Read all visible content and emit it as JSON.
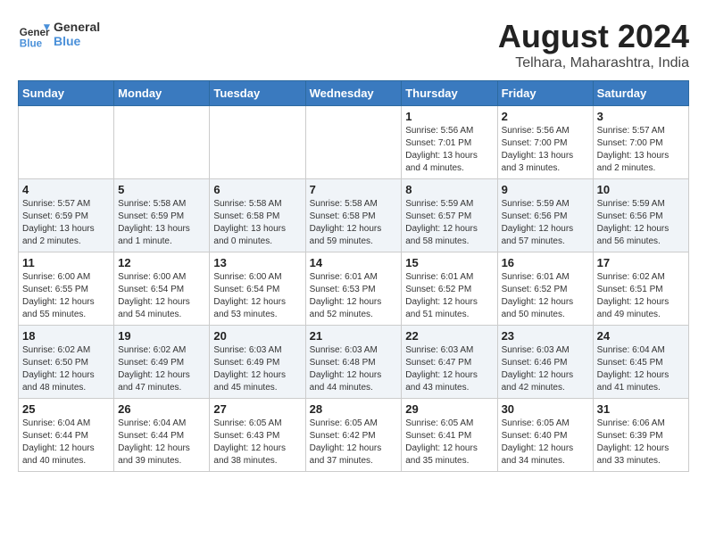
{
  "header": {
    "logo_line1": "General",
    "logo_line2": "Blue",
    "month_year": "August 2024",
    "location": "Telhara, Maharashtra, India"
  },
  "weekdays": [
    "Sunday",
    "Monday",
    "Tuesday",
    "Wednesday",
    "Thursday",
    "Friday",
    "Saturday"
  ],
  "weeks": [
    [
      {
        "day": "",
        "info": ""
      },
      {
        "day": "",
        "info": ""
      },
      {
        "day": "",
        "info": ""
      },
      {
        "day": "",
        "info": ""
      },
      {
        "day": "1",
        "info": "Sunrise: 5:56 AM\nSunset: 7:01 PM\nDaylight: 13 hours\nand 4 minutes."
      },
      {
        "day": "2",
        "info": "Sunrise: 5:56 AM\nSunset: 7:00 PM\nDaylight: 13 hours\nand 3 minutes."
      },
      {
        "day": "3",
        "info": "Sunrise: 5:57 AM\nSunset: 7:00 PM\nDaylight: 13 hours\nand 2 minutes."
      }
    ],
    [
      {
        "day": "4",
        "info": "Sunrise: 5:57 AM\nSunset: 6:59 PM\nDaylight: 13 hours\nand 2 minutes."
      },
      {
        "day": "5",
        "info": "Sunrise: 5:58 AM\nSunset: 6:59 PM\nDaylight: 13 hours\nand 1 minute."
      },
      {
        "day": "6",
        "info": "Sunrise: 5:58 AM\nSunset: 6:58 PM\nDaylight: 13 hours\nand 0 minutes."
      },
      {
        "day": "7",
        "info": "Sunrise: 5:58 AM\nSunset: 6:58 PM\nDaylight: 12 hours\nand 59 minutes."
      },
      {
        "day": "8",
        "info": "Sunrise: 5:59 AM\nSunset: 6:57 PM\nDaylight: 12 hours\nand 58 minutes."
      },
      {
        "day": "9",
        "info": "Sunrise: 5:59 AM\nSunset: 6:56 PM\nDaylight: 12 hours\nand 57 minutes."
      },
      {
        "day": "10",
        "info": "Sunrise: 5:59 AM\nSunset: 6:56 PM\nDaylight: 12 hours\nand 56 minutes."
      }
    ],
    [
      {
        "day": "11",
        "info": "Sunrise: 6:00 AM\nSunset: 6:55 PM\nDaylight: 12 hours\nand 55 minutes."
      },
      {
        "day": "12",
        "info": "Sunrise: 6:00 AM\nSunset: 6:54 PM\nDaylight: 12 hours\nand 54 minutes."
      },
      {
        "day": "13",
        "info": "Sunrise: 6:00 AM\nSunset: 6:54 PM\nDaylight: 12 hours\nand 53 minutes."
      },
      {
        "day": "14",
        "info": "Sunrise: 6:01 AM\nSunset: 6:53 PM\nDaylight: 12 hours\nand 52 minutes."
      },
      {
        "day": "15",
        "info": "Sunrise: 6:01 AM\nSunset: 6:52 PM\nDaylight: 12 hours\nand 51 minutes."
      },
      {
        "day": "16",
        "info": "Sunrise: 6:01 AM\nSunset: 6:52 PM\nDaylight: 12 hours\nand 50 minutes."
      },
      {
        "day": "17",
        "info": "Sunrise: 6:02 AM\nSunset: 6:51 PM\nDaylight: 12 hours\nand 49 minutes."
      }
    ],
    [
      {
        "day": "18",
        "info": "Sunrise: 6:02 AM\nSunset: 6:50 PM\nDaylight: 12 hours\nand 48 minutes."
      },
      {
        "day": "19",
        "info": "Sunrise: 6:02 AM\nSunset: 6:49 PM\nDaylight: 12 hours\nand 47 minutes."
      },
      {
        "day": "20",
        "info": "Sunrise: 6:03 AM\nSunset: 6:49 PM\nDaylight: 12 hours\nand 45 minutes."
      },
      {
        "day": "21",
        "info": "Sunrise: 6:03 AM\nSunset: 6:48 PM\nDaylight: 12 hours\nand 44 minutes."
      },
      {
        "day": "22",
        "info": "Sunrise: 6:03 AM\nSunset: 6:47 PM\nDaylight: 12 hours\nand 43 minutes."
      },
      {
        "day": "23",
        "info": "Sunrise: 6:03 AM\nSunset: 6:46 PM\nDaylight: 12 hours\nand 42 minutes."
      },
      {
        "day": "24",
        "info": "Sunrise: 6:04 AM\nSunset: 6:45 PM\nDaylight: 12 hours\nand 41 minutes."
      }
    ],
    [
      {
        "day": "25",
        "info": "Sunrise: 6:04 AM\nSunset: 6:44 PM\nDaylight: 12 hours\nand 40 minutes."
      },
      {
        "day": "26",
        "info": "Sunrise: 6:04 AM\nSunset: 6:44 PM\nDaylight: 12 hours\nand 39 minutes."
      },
      {
        "day": "27",
        "info": "Sunrise: 6:05 AM\nSunset: 6:43 PM\nDaylight: 12 hours\nand 38 minutes."
      },
      {
        "day": "28",
        "info": "Sunrise: 6:05 AM\nSunset: 6:42 PM\nDaylight: 12 hours\nand 37 minutes."
      },
      {
        "day": "29",
        "info": "Sunrise: 6:05 AM\nSunset: 6:41 PM\nDaylight: 12 hours\nand 35 minutes."
      },
      {
        "day": "30",
        "info": "Sunrise: 6:05 AM\nSunset: 6:40 PM\nDaylight: 12 hours\nand 34 minutes."
      },
      {
        "day": "31",
        "info": "Sunrise: 6:06 AM\nSunset: 6:39 PM\nDaylight: 12 hours\nand 33 minutes."
      }
    ]
  ]
}
